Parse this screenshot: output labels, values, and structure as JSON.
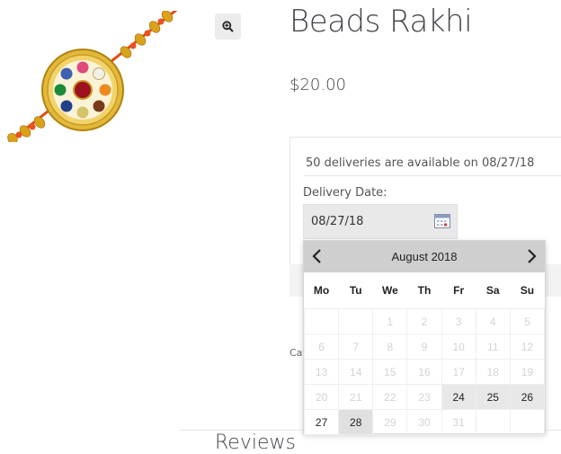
{
  "product": {
    "title": "Beads Rakhi",
    "price": "$20.00",
    "image_name": "beads-rakhi-image"
  },
  "delivery": {
    "availability": "50 deliveries are available on 08/27/18",
    "label": "Delivery Date:",
    "value": "08/27/18"
  },
  "meta": {
    "category_label": "Cat"
  },
  "reviews": {
    "heading": "Reviews"
  },
  "datepicker": {
    "month": "August 2018",
    "weekdays": [
      "Mo",
      "Tu",
      "We",
      "Th",
      "Fr",
      "Sa",
      "Su"
    ],
    "weeks": [
      [
        {
          "d": ""
        },
        {
          "d": ""
        },
        {
          "d": "1"
        },
        {
          "d": "2"
        },
        {
          "d": "3"
        },
        {
          "d": "4"
        },
        {
          "d": "5"
        }
      ],
      [
        {
          "d": "6"
        },
        {
          "d": "7"
        },
        {
          "d": "8"
        },
        {
          "d": "9"
        },
        {
          "d": "10"
        },
        {
          "d": "11"
        },
        {
          "d": "12"
        }
      ],
      [
        {
          "d": "13"
        },
        {
          "d": "14"
        },
        {
          "d": "15"
        },
        {
          "d": "16"
        },
        {
          "d": "17"
        },
        {
          "d": "18"
        },
        {
          "d": "19"
        }
      ],
      [
        {
          "d": "20"
        },
        {
          "d": "21"
        },
        {
          "d": "22"
        },
        {
          "d": "23"
        },
        {
          "d": "24",
          "s": "enabled"
        },
        {
          "d": "25",
          "s": "enabled"
        },
        {
          "d": "26",
          "s": "enabled"
        }
      ],
      [
        {
          "d": "27",
          "s": "today"
        },
        {
          "d": "28",
          "s": "selected"
        },
        {
          "d": "29"
        },
        {
          "d": "30"
        },
        {
          "d": "31"
        },
        {
          "d": ""
        },
        {
          "d": ""
        }
      ]
    ]
  },
  "icons": {
    "zoom": "zoom-in-icon",
    "calendar": "calendar-icon",
    "prev": "chevron-left-icon",
    "next": "chevron-right-icon"
  }
}
